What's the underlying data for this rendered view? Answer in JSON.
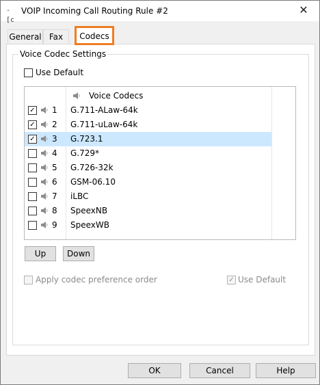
{
  "window": {
    "title": "VOIP Incoming Call Routing Rule #2",
    "close_glyph": "✕"
  },
  "tabs": [
    {
      "label": "General"
    },
    {
      "label": "Fax"
    },
    {
      "label": "Codecs",
      "active": true
    }
  ],
  "group": {
    "title": "Voice Codec Settings"
  },
  "use_default_top": {
    "label": "Use Default",
    "checked": false
  },
  "codec_list": {
    "header": "Voice Codecs",
    "rows": [
      {
        "num": "1",
        "name": "G.711-ALaw-64k",
        "checked": true,
        "selected": false
      },
      {
        "num": "2",
        "name": "G.711-uLaw-64k",
        "checked": true,
        "selected": false
      },
      {
        "num": "3",
        "name": "G.723.1",
        "checked": true,
        "selected": true
      },
      {
        "num": "4",
        "name": "G.729*",
        "checked": false,
        "selected": false
      },
      {
        "num": "5",
        "name": "G.726-32k",
        "checked": false,
        "selected": false
      },
      {
        "num": "6",
        "name": "GSM-06.10",
        "checked": false,
        "selected": false
      },
      {
        "num": "7",
        "name": "iLBC",
        "checked": false,
        "selected": false
      },
      {
        "num": "8",
        "name": "SpeexNB",
        "checked": false,
        "selected": false
      },
      {
        "num": "9",
        "name": "SpeexWB",
        "checked": false,
        "selected": false
      }
    ]
  },
  "buttons": {
    "up": "Up",
    "down": "Down",
    "ok": "OK",
    "cancel": "Cancel",
    "help": "Help"
  },
  "apply_order": {
    "label": "Apply codec preference order",
    "checked": false,
    "enabled": false
  },
  "use_default_bottom": {
    "label": "Use Default",
    "checked": true,
    "enabled": false
  },
  "colors": {
    "tab_highlight": "#ef7d22",
    "selection": "#cce8ff"
  }
}
